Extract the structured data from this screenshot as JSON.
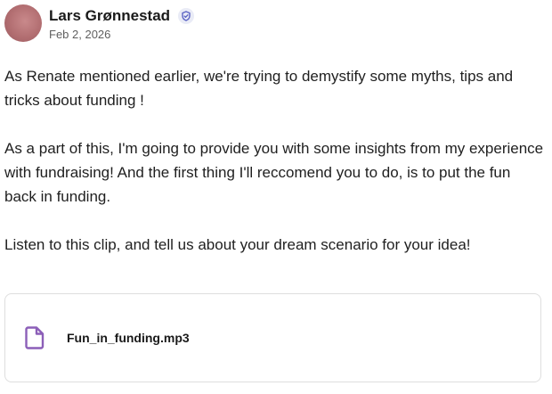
{
  "post": {
    "author": {
      "name": "Lars Grønnestad",
      "avatar_icon": "avatar-photo",
      "verified_icon": "shield-check-icon",
      "avatar_color": "#b26e71"
    },
    "date": "Feb 2, 2026",
    "paragraphs": [
      "As Renate mentioned earlier, we're trying to demystify some myths, tips and tricks about funding !",
      "As a part of this, I'm going to provide you with some insights from my experience with fundraising! And the first thing I'll reccomend you to do, is to put the fun back in funding.",
      "Listen to this clip, and tell us about your dream scenario for your idea!"
    ],
    "attachment": {
      "file_name": "Fun_in_funding.mp3",
      "icon": "file-icon",
      "icon_color": "#8c5fb8"
    }
  },
  "colors": {
    "verified_badge_bg": "#e9ebf6",
    "verified_badge_fg": "#5b63c4",
    "border": "#dedede",
    "text": "#1f1f1f",
    "muted": "#5f5f5f"
  }
}
